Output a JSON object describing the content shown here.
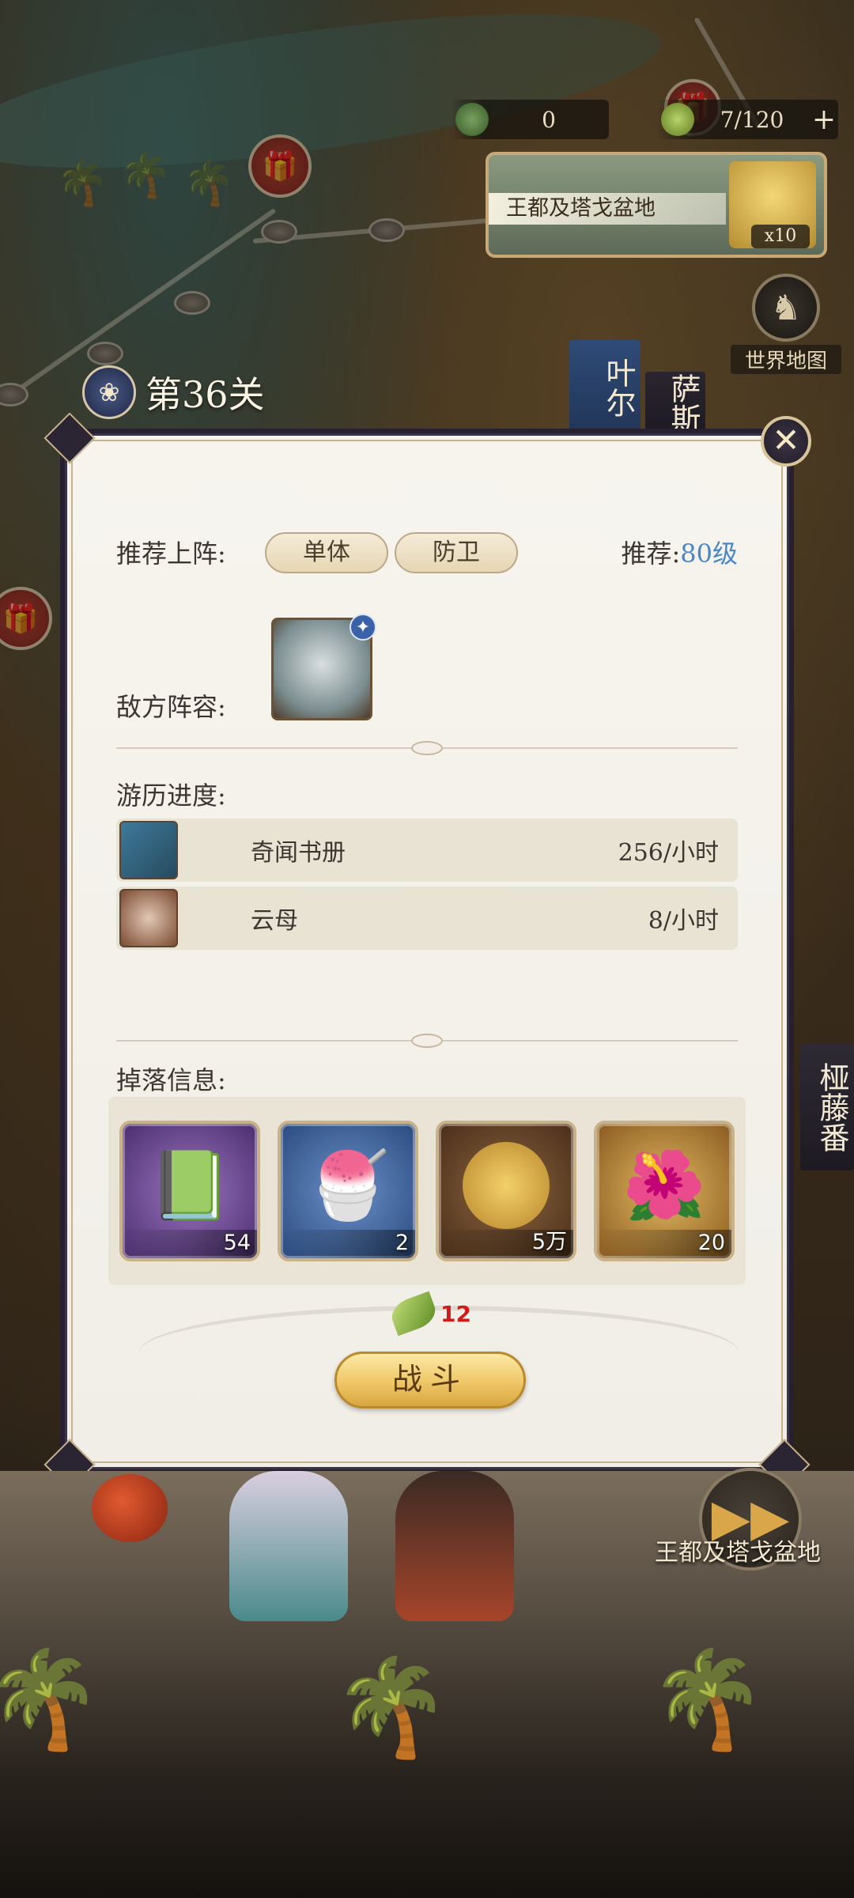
{
  "resources": {
    "item_a": {
      "icon": "grass-icon",
      "value": "0"
    },
    "stamina": {
      "icon": "leaf-icon",
      "value": "7/120",
      "add": "+"
    }
  },
  "region_card": {
    "name": "王都及塔戈盆地",
    "badge": "x10"
  },
  "world_map": {
    "icon": "world-map-icon",
    "label": "世界地图"
  },
  "stage": {
    "title": "第36关"
  },
  "side_tags": {
    "left": "叶尔",
    "right": "萨斯",
    "far_right": "桠藤番"
  },
  "dialog": {
    "recommend_label": "推荐上阵:",
    "recommend_tags": [
      "单体",
      "防卫"
    ],
    "recommend_level_label": "推荐:",
    "recommend_level": "80级",
    "enemy_label": "敌方阵容:",
    "progress_label": "游历进度:",
    "progress_items": [
      {
        "name": "奇闻书册",
        "rate": "256/小时"
      },
      {
        "name": "云母",
        "rate": "8/小时"
      }
    ],
    "drops_label": "掉落信息:",
    "drops": [
      {
        "name": "book",
        "qty": "54",
        "color": "#6a4a8e"
      },
      {
        "name": "bowl",
        "qty": "2",
        "color": "#3b5d92"
      },
      {
        "name": "coin",
        "qty": "5万",
        "color": "#6b4a2c"
      },
      {
        "name": "peony",
        "qty": "20",
        "color": "#b58a3a"
      }
    ],
    "cost": "12",
    "fight_label": "战斗",
    "close_icon": "close-icon"
  },
  "next_area": {
    "icon": "fast-forward-icon",
    "label": "王都及塔戈盆地"
  }
}
